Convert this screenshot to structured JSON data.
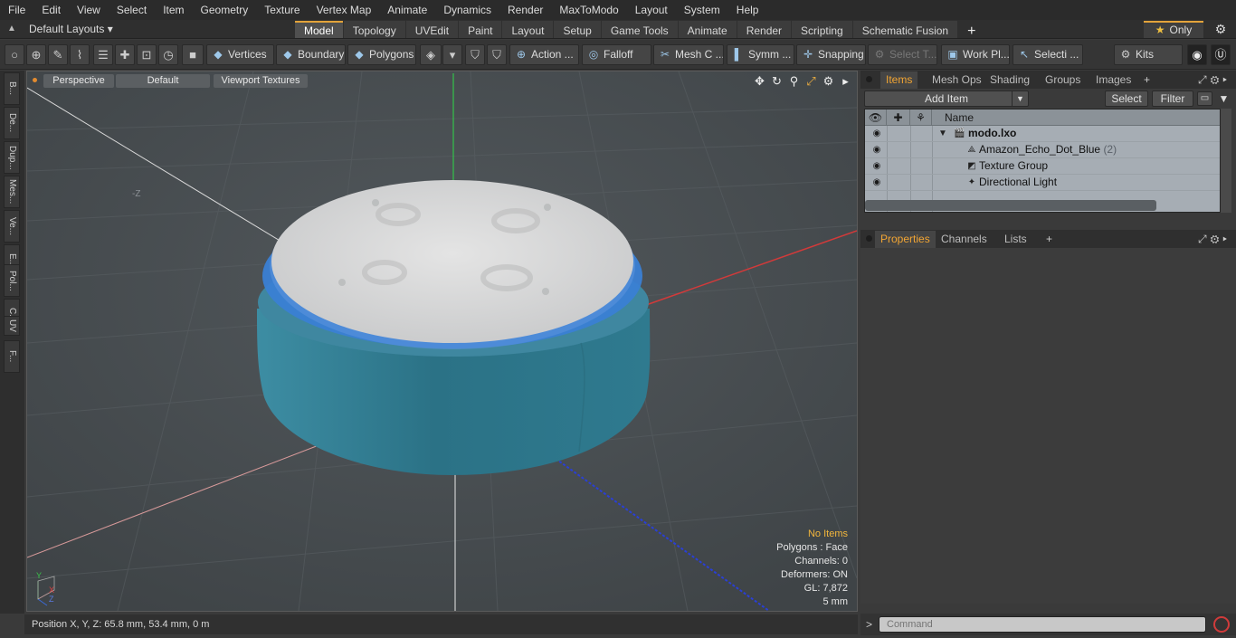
{
  "menu": [
    "File",
    "Edit",
    "View",
    "Select",
    "Item",
    "Geometry",
    "Texture",
    "Vertex Map",
    "Animate",
    "Dynamics",
    "Render",
    "MaxToModo",
    "Layout",
    "System",
    "Help"
  ],
  "layout": {
    "preset": "Default Layouts ▾",
    "tabs": [
      "Model",
      "Topology",
      "UVEdit",
      "Paint",
      "Layout",
      "Setup",
      "Game Tools",
      "Animate",
      "Render",
      "Scripting",
      "Schematic Fusion"
    ],
    "active_tab": "Model",
    "only": "Only"
  },
  "toolbar": {
    "vertices": "Vertices",
    "boundary": "Boundary",
    "polygons": "Polygons",
    "action": "Action ...",
    "falloff": "Falloff",
    "mesh": "Mesh C ...",
    "symm": "Symm ...",
    "snapping": "Snapping",
    "select_t": "Select T...",
    "work_pl": "Work Pl...",
    "selecti": "Selecti ...",
    "kits": "Kits"
  },
  "leftstrip": [
    "B...",
    "De...",
    "Dup...",
    "Mes...",
    "Ve...",
    "E...",
    "Pol...",
    "C...",
    "UV",
    "F..."
  ],
  "viewport": {
    "view": "Perspective",
    "shading": "Default",
    "textures": "Viewport Textures",
    "axis_label": "-Z",
    "info": {
      "selection": "No Items",
      "polygons": "Polygons : Face",
      "channels": "Channels: 0",
      "deformers": "Deformers: ON",
      "gl": "GL: 7,872",
      "unit": "5 mm"
    },
    "gizmo": {
      "y": "Y",
      "x": "X",
      "z": "Z"
    }
  },
  "status": {
    "position": "Position X, Y, Z:   65.8 mm, 53.4 mm, 0 m"
  },
  "items_panel": {
    "tabs": [
      "Items",
      "Mesh Ops",
      "Shading",
      "Groups",
      "Images"
    ],
    "active": "Items",
    "add_item": "Add Item",
    "select": "Select",
    "filter": "Filter",
    "col_name": "Name",
    "rows": [
      {
        "name": "modo.lxo",
        "count": ""
      },
      {
        "name": "Amazon_Echo_Dot_Blue",
        "count": "(2)"
      },
      {
        "name": "Texture Group",
        "count": ""
      },
      {
        "name": "Directional Light",
        "count": ""
      }
    ]
  },
  "props_panel": {
    "tabs": [
      "Properties",
      "Channels",
      "Lists"
    ],
    "active": "Properties"
  },
  "command": {
    "prompt": ">",
    "placeholder": "Command"
  },
  "colors": {
    "accent": "#e3a33a",
    "viewport_bg": "#484d51",
    "device_body": "#3a8fa6",
    "device_top": "#dcdcdc",
    "light_ring": "#4a7ed8"
  }
}
